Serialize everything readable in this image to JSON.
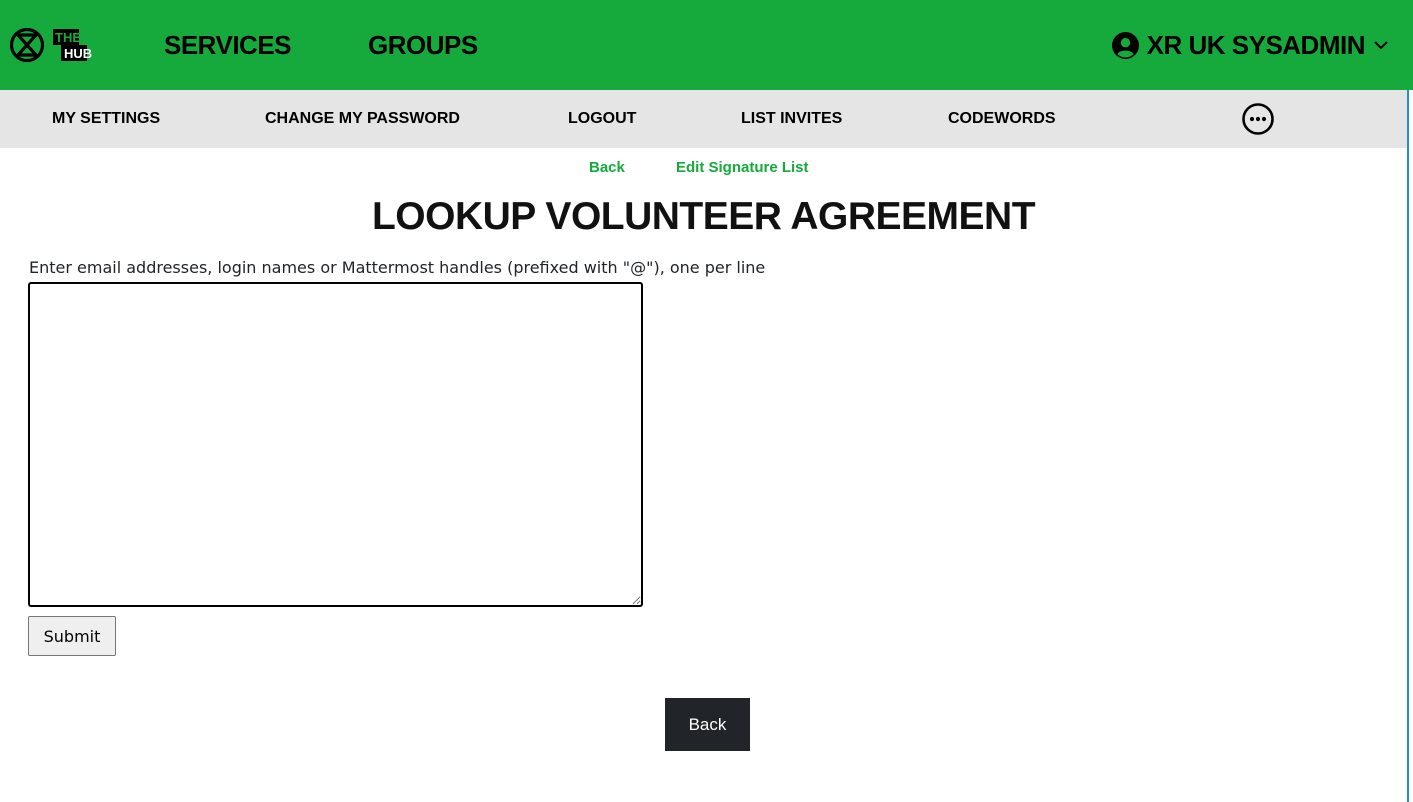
{
  "header": {
    "brand_mark_text": [
      "THE",
      "HUB"
    ],
    "nav": [
      {
        "label": "SERVICES"
      },
      {
        "label": "GROUPS"
      }
    ],
    "user_menu": {
      "label": "XR UK SYSADMIN",
      "icon": "user-circle-icon",
      "caret": "chevron-down-icon"
    },
    "bar_color": "#15aa3b"
  },
  "subnav": {
    "items": [
      {
        "label": "MY SETTINGS"
      },
      {
        "label": "CHANGE MY PASSWORD"
      },
      {
        "label": "LOGOUT"
      },
      {
        "label": "LIST INVITES"
      },
      {
        "label": "CODEWORDS"
      }
    ],
    "more_icon": "ellipsis-circle-icon",
    "bar_color": "#e5e5e5"
  },
  "links": {
    "back": "Back",
    "edit_signature_list": "Edit Signature List",
    "color": "#15aa3b"
  },
  "main": {
    "title": "LOOKUP VOLUNTEER AGREEMENT",
    "instructions": "Enter email addresses, login names or Mattermost handles (prefixed with \"@\"), one per line",
    "textarea_value": "",
    "submit_label": "Submit"
  },
  "footer": {
    "back_label": "Back",
    "back_color": "#212529"
  }
}
